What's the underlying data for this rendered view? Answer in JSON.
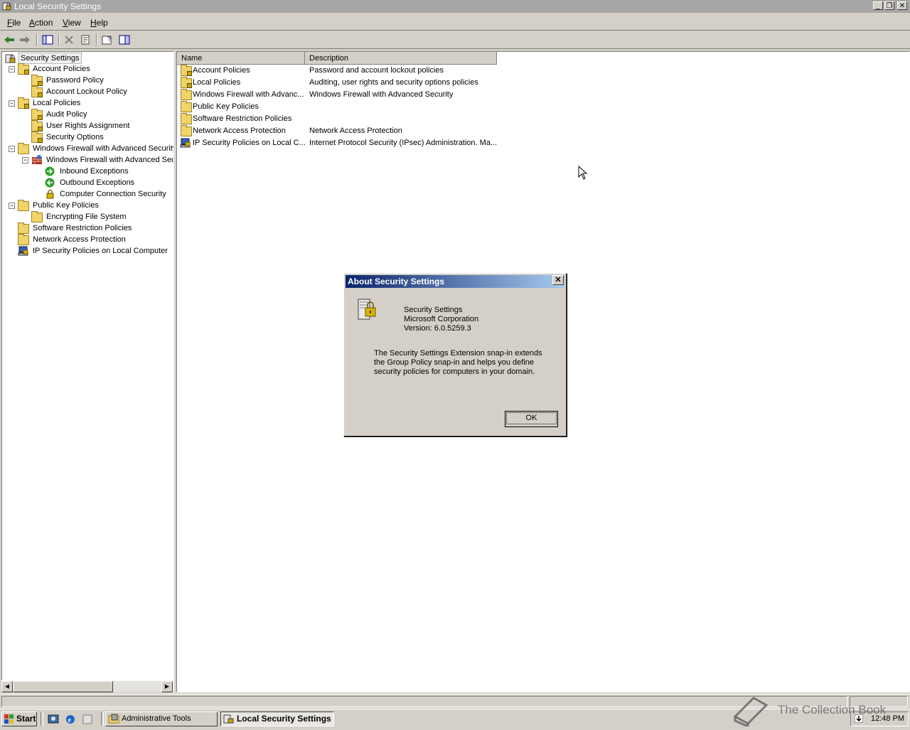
{
  "window": {
    "title": "Local Security Settings"
  },
  "menubar": {
    "items": [
      {
        "label": "File",
        "hotkey": "F",
        "rest": "ile"
      },
      {
        "label": "Action",
        "hotkey": "A",
        "rest": "ction"
      },
      {
        "label": "View",
        "hotkey": "V",
        "rest": "iew"
      },
      {
        "label": "Help",
        "hotkey": "H",
        "rest": "elp"
      }
    ]
  },
  "toolbar": {
    "buttons": [
      "back-icon",
      "forward-icon",
      "show-hide-tree-icon",
      "delete-icon",
      "export-list-icon",
      "properties-help-icon",
      "show-hide-action-pane-icon"
    ]
  },
  "tree": {
    "root": "Security Settings",
    "items": [
      {
        "label": "Account Policies"
      },
      {
        "label": "Password Policy"
      },
      {
        "label": "Account Lockout Policy"
      },
      {
        "label": "Local Policies"
      },
      {
        "label": "Audit Policy"
      },
      {
        "label": "User Rights Assignment"
      },
      {
        "label": "Security Options"
      },
      {
        "label": "Windows Firewall with Advanced Security"
      },
      {
        "label": "Windows Firewall with Advanced Sec"
      },
      {
        "label": "Inbound Exceptions"
      },
      {
        "label": "Outbound Exceptions"
      },
      {
        "label": "Computer Connection Security"
      },
      {
        "label": "Public Key Policies"
      },
      {
        "label": "Encrypting File System"
      },
      {
        "label": "Software Restriction Policies"
      },
      {
        "label": "Network Access Protection"
      },
      {
        "label": "IP Security Policies on Local Computer"
      }
    ]
  },
  "list": {
    "columns": [
      "Name",
      "Description"
    ],
    "rows": [
      {
        "name": "Account Policies",
        "description": "Password and account lockout policies"
      },
      {
        "name": "Local Policies",
        "description": "Auditing, user rights and security options policies"
      },
      {
        "name": "Windows Firewall with Advanc...",
        "description": "Windows Firewall with Advanced Security"
      },
      {
        "name": "Public Key Policies",
        "description": ""
      },
      {
        "name": "Software Restriction Policies",
        "description": ""
      },
      {
        "name": "Network Access Protection",
        "description": "Network Access Protection"
      },
      {
        "name": "IP Security Policies on Local C...",
        "description": "Internet Protocol Security (IPsec) Administration. Ma..."
      }
    ]
  },
  "dialog": {
    "title": "About Security Settings",
    "product": "Security Settings",
    "company": "Microsoft Corporation",
    "version": "Version: 6.0.5259.3",
    "description": "The Security Settings Extension snap-in extends the Group Policy snap-in and helps you define security policies for computers in your domain.",
    "ok_label": "OK"
  },
  "taskbar": {
    "start_label": "Start",
    "tasks": [
      {
        "label": "Administrative Tools"
      },
      {
        "label": "Local Security Settings"
      }
    ],
    "clock": "12:48 PM"
  },
  "watermark": "The Collection Book",
  "colors": {
    "title_inactive": "#a6a6a6",
    "dialog_title_start": "#0a246a",
    "dialog_title_end": "#a6caf0",
    "face": "#d4d0c8"
  }
}
